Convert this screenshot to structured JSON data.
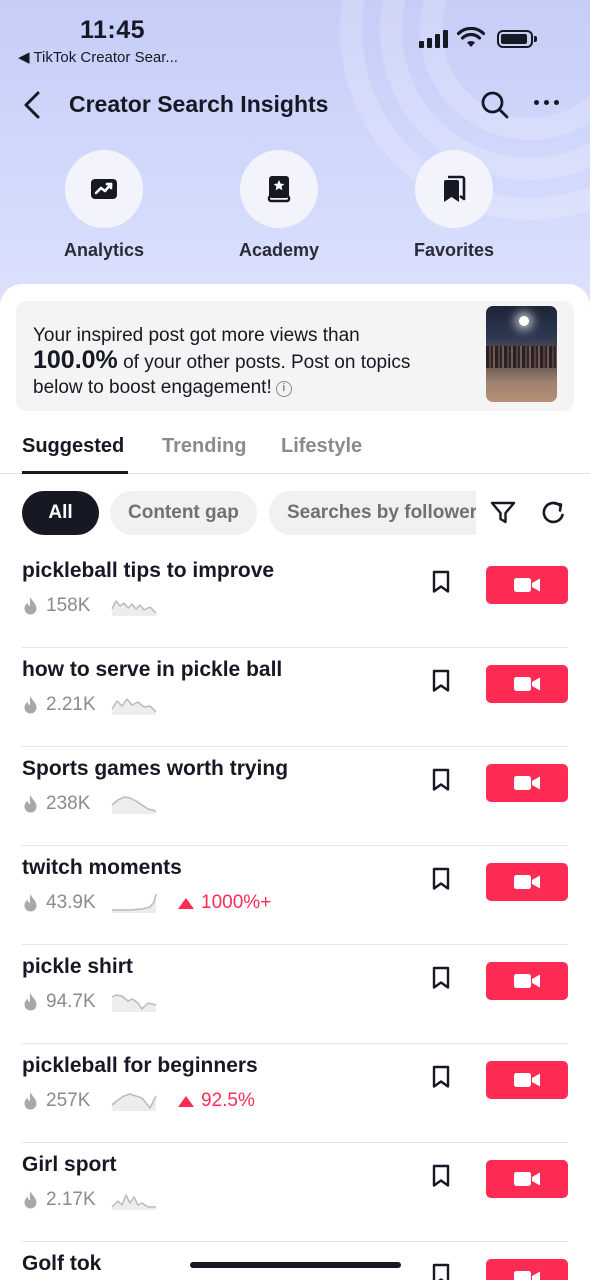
{
  "status_bar": {
    "time": "11:45",
    "back_app": "◀ TikTok Creator Sear..."
  },
  "nav": {
    "title": "Creator Search Insights",
    "back_icon": "chevron-left-icon",
    "search_icon": "search-icon",
    "more_icon": "more-icon"
  },
  "shortcuts": [
    {
      "label": "Analytics",
      "icon": "analytics-icon"
    },
    {
      "label": "Academy",
      "icon": "academy-book-icon"
    },
    {
      "label": "Favorites",
      "icon": "bookmarks-icon"
    }
  ],
  "banner": {
    "line1": "Your inspired post got more views than",
    "percent": "100.0%",
    "line2": " of your other posts. Post on topics",
    "line3": "below to boost engagement!",
    "info_icon": "info-icon"
  },
  "tabs": [
    {
      "label": "Suggested",
      "active": true
    },
    {
      "label": "Trending",
      "active": false
    },
    {
      "label": "Lifestyle",
      "active": false
    }
  ],
  "chips": [
    {
      "label": "All",
      "active": true
    },
    {
      "label": "Content gap",
      "active": false
    },
    {
      "label": "Searches by followers",
      "active": false
    }
  ],
  "colors": {
    "accent": "#fe2c55",
    "text": "#161823",
    "muted": "#8a8b91"
  },
  "topics": [
    {
      "title": "pickleball tips to improve",
      "count": "158K",
      "growth": ""
    },
    {
      "title": "how to serve in pickle ball",
      "count": "2.21K",
      "growth": ""
    },
    {
      "title": "Sports games worth trying",
      "count": "238K",
      "growth": ""
    },
    {
      "title": "twitch moments",
      "count": "43.9K",
      "growth": "1000%+"
    },
    {
      "title": "pickle shirt",
      "count": "94.7K",
      "growth": ""
    },
    {
      "title": "pickleball for beginners",
      "count": "257K",
      "growth": "92.5%"
    },
    {
      "title": "Girl sport",
      "count": "2.17K",
      "growth": ""
    },
    {
      "title": "Golf tok",
      "count": "",
      "growth": ""
    }
  ]
}
